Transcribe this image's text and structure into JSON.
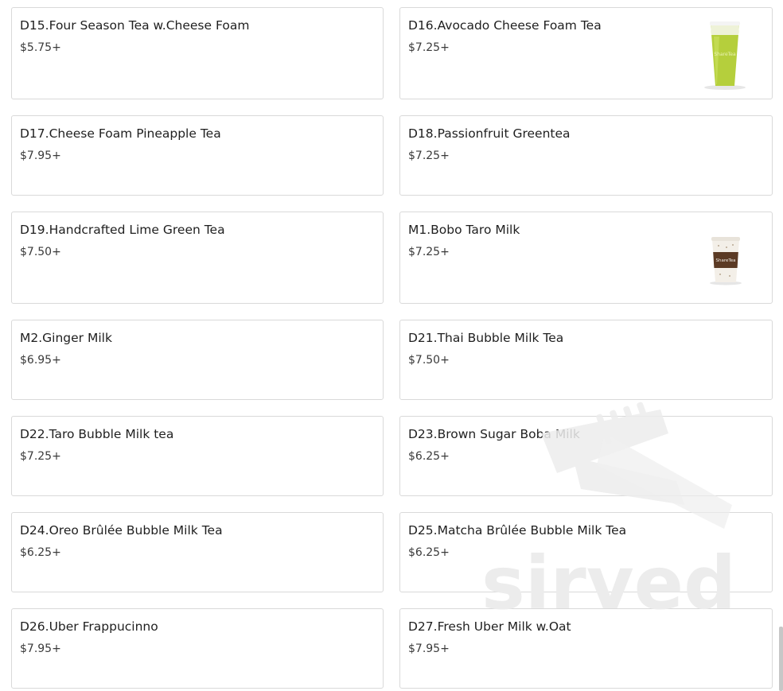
{
  "menu_items": [
    {
      "name": "D15.Four Season Tea w.Cheese Foam",
      "price": "$5.75+"
    },
    {
      "name": "D16.Avocado Cheese Foam Tea",
      "price": "$7.25+",
      "image": "green-drink-cup"
    },
    {
      "name": "D17.Cheese Foam Pineapple Tea",
      "price": "$7.95+"
    },
    {
      "name": "D18.Passionfruit Greentea",
      "price": "$7.25+"
    },
    {
      "name": "D19.Handcrafted Lime Green Tea",
      "price": "$7.50+"
    },
    {
      "name": "M1.Bobo Taro Milk",
      "price": "$7.25+",
      "image": "taro-milk-cup"
    },
    {
      "name": "M2.Ginger Milk",
      "price": "$6.95+"
    },
    {
      "name": "D21.Thai Bubble Milk Tea",
      "price": "$7.50+"
    },
    {
      "name": "D22.Taro Bubble Milk tea",
      "price": "$7.25+"
    },
    {
      "name": "D23.Brown Sugar Boba Milk",
      "price": "$6.25+"
    },
    {
      "name": "D24.Oreo Brûlée Bubble Milk Tea",
      "price": "$6.25+"
    },
    {
      "name": "D25.Matcha Brûlée Bubble Milk Tea",
      "price": "$6.25+"
    },
    {
      "name": "D26.Uber Frappucinno",
      "price": "$7.95+"
    },
    {
      "name": "D27.Fresh Uber Milk w.Oat",
      "price": "$7.95+"
    }
  ],
  "watermark": {
    "text": "sirved",
    "icon": "fork-knife-icon"
  },
  "colors": {
    "border": "#d9d9d9",
    "text": "#1f1f1f",
    "watermark": "#ececec"
  }
}
